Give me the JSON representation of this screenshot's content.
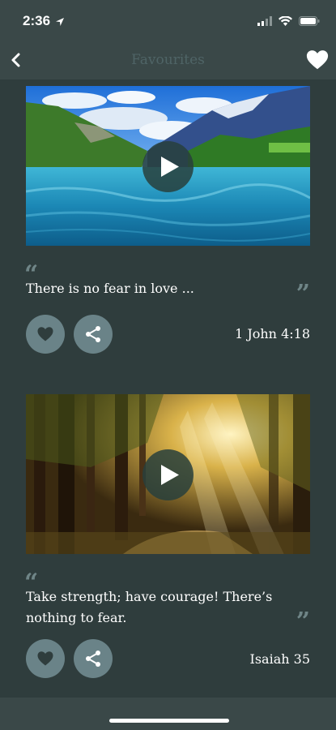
{
  "status": {
    "time": "2:36"
  },
  "header": {
    "title": "Favourites"
  },
  "cards": [
    {
      "quote": "There is no fear in love ...",
      "reference": "1 John 4:18"
    },
    {
      "quote": "Take strength; have courage! There’s nothing to fear.",
      "reference": "Isaiah 35"
    }
  ],
  "colors": {
    "background": "#2f3d3d",
    "bar": "#3a4848",
    "button": "#6a8388"
  },
  "icons": [
    "back-chevron-icon",
    "heart-icon",
    "play-icon",
    "share-icon",
    "quote-open-icon",
    "quote-close-icon"
  ]
}
